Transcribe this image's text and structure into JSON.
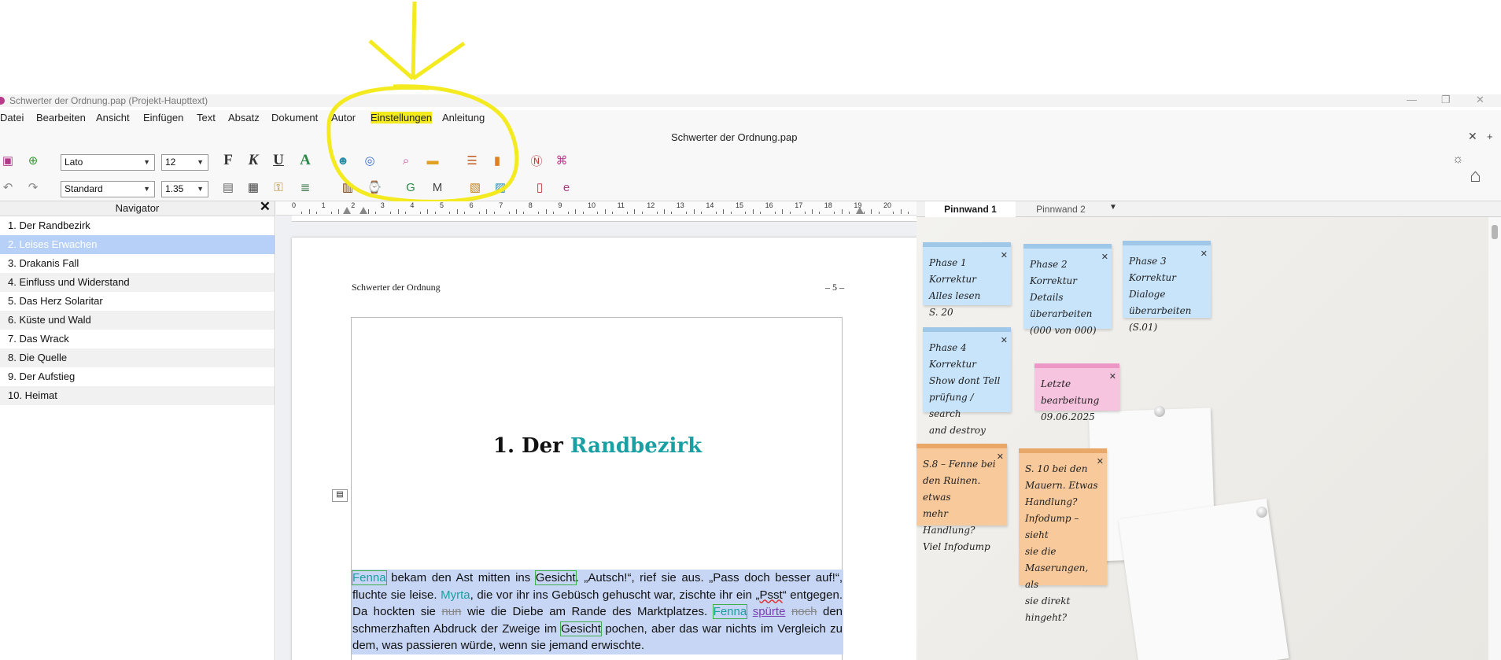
{
  "window": {
    "title": "Schwerter der Ordnung.pap  (Projekt-Haupttext)",
    "controls": [
      "—",
      "❐",
      "✕"
    ]
  },
  "menu": [
    "Datei",
    "Bearbeiten",
    "Ansicht",
    "Einfügen",
    "Text",
    "Absatz",
    "Dokument",
    "Autor",
    "Einstellungen",
    "Anleitung"
  ],
  "document_tab": {
    "title": "Schwerter der Ordnung.pap",
    "close": "✕",
    "add": "+"
  },
  "toolbar": {
    "font": "Lato",
    "size": "12",
    "style": "Standard",
    "line_spacing": "1.35",
    "bold": "F",
    "italic": "K",
    "underline": "U",
    "font_color": "A"
  },
  "navigator": {
    "title": "Navigator",
    "close": "✕",
    "selected_index": 1,
    "items": [
      "1. Der Randbezirk",
      "2. Leises Erwachen",
      "3. Drakanis Fall",
      "4. Einfluss und Widerstand",
      "5. Das Herz Solaritar",
      "6. Küste und Wald",
      "7. Das Wrack",
      "8. Die Quelle",
      "9. Der Aufstieg",
      "10. Heimat"
    ]
  },
  "ruler": {
    "numbers": [
      "0",
      "1",
      "2",
      "3",
      "4",
      "5",
      "6",
      "7",
      "8",
      "9",
      "10",
      "11",
      "12",
      "13",
      "14",
      "15",
      "16",
      "17",
      "18",
      "19",
      "20"
    ]
  },
  "page": {
    "header_left": "Schwerter der Ordnung",
    "header_right": "– 5 –",
    "chapter_prefix": "1. Der ",
    "chapter_highlight": "Randbezirk",
    "body": {
      "fenna": "Fenna",
      "t1": " bekam den Ast mitten ins ",
      "gesicht": "Gesicht",
      "t2": ". „Autsch!“, rief sie aus. „Pass doch besser auf!“, fluchte sie leise. ",
      "myrta": "Myrta",
      "t3": ", die vor ihr ins Gebüsch gehuscht war, zischte ihr ein „",
      "psst": "Psst",
      "t4": "“ entgegen. Da hockten sie ",
      "nun": "nun",
      "t5": " wie die Diebe am Rande des Marktplatzes. ",
      "fenna2": "Fenna",
      "spuerte": "spürte",
      "noch": "noch",
      "t6": " den schmerzhaften Abdruck der Zweige im ",
      "gesicht2": "Gesicht",
      "t7": " pochen, aber das war nichts im Vergleich zu dem, was passieren würde, wenn sie jemand erwischte."
    }
  },
  "pinboard": {
    "tabs": [
      "Pinnwand 1",
      "Pinnwand 2"
    ],
    "notes": [
      {
        "color": "blue",
        "lines": [
          "Phase 1 Korrektur",
          "Alles lesen",
          "S. 20"
        ]
      },
      {
        "color": "blue",
        "lines": [
          "Phase 2 Korrektur",
          "Details",
          "überarbeiten",
          "(000 von 000)"
        ]
      },
      {
        "color": "blue",
        "lines": [
          "Phase 3 Korrektur",
          "Dialoge",
          "überarbeiten",
          "(S.01)"
        ]
      },
      {
        "color": "blue",
        "lines": [
          "Phase 4 Korrektur",
          "Show dont Tell",
          "prüfung / search",
          "and destroy"
        ]
      },
      {
        "color": "pink",
        "lines": [
          "Letzte bearbeitung",
          "09.06.2025"
        ]
      },
      {
        "color": "orange",
        "lines": [
          "S.8 – Fenne bei",
          "den Ruinen. etwas",
          "mehr Handlung?",
          "Viel Infodump"
        ]
      },
      {
        "color": "orange",
        "lines": [
          "S. 10 bei den",
          "Mauern. Etwas",
          "Handlung?",
          "Infodump – sieht",
          "sie die",
          "Maserungen, als",
          "sie direkt hingeht?"
        ]
      }
    ],
    "note_close": "✕"
  },
  "colors": {
    "accent_teal": "#1aa0a3",
    "selection": "#c7d6f5",
    "nav_selected": "#b7d0f7"
  }
}
